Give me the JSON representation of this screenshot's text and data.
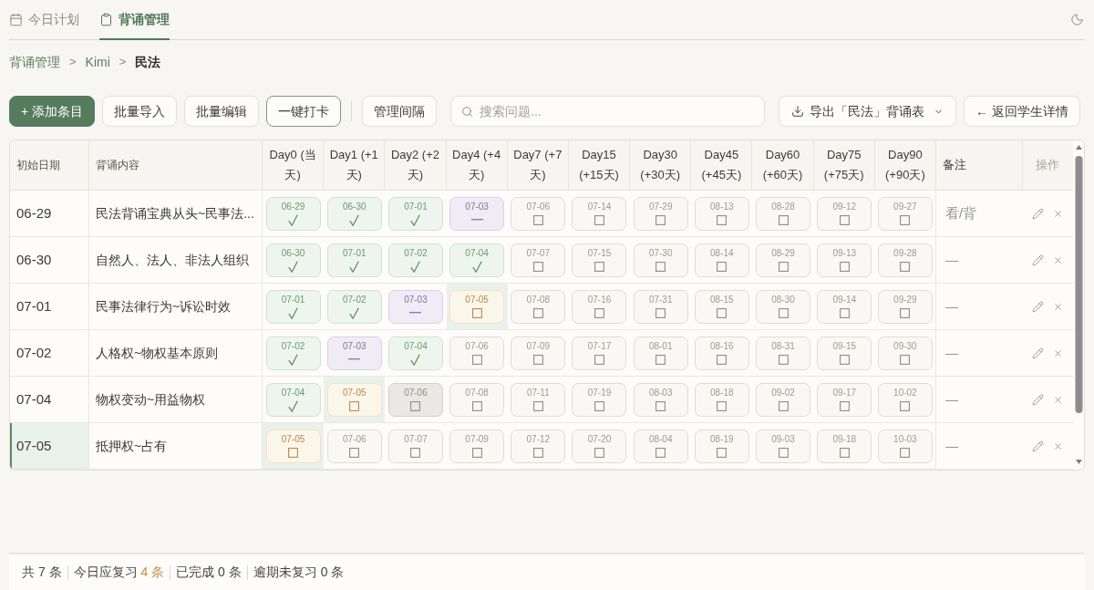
{
  "tabs": [
    {
      "label": "今日计划",
      "selected": false
    },
    {
      "label": "背诵管理",
      "selected": true
    }
  ],
  "breadcrumb": [
    {
      "label": "背诵管理",
      "separator": ">",
      "current": false
    },
    {
      "label": "Kimi",
      "separator": ">",
      "current": false
    },
    {
      "label": "民法",
      "current": true
    }
  ],
  "toolbar": {
    "buttons": [
      {
        "label": "+ 添加条目",
        "kind": "primary"
      },
      {
        "label": "批量导入",
        "kind": "default"
      },
      {
        "label": "批量编辑",
        "kind": "default"
      },
      {
        "label": "一键打卡",
        "kind": "accent"
      }
    ],
    "interval_button": {
      "label": "管理间隔"
    },
    "search": {
      "placeholder": "搜索问题..."
    },
    "export_button": {
      "label": "导出「民法」背诵表"
    },
    "back_button": {
      "label": "← 返回学生详情"
    }
  },
  "table": {
    "columns": [
      "初始日期",
      "背诵内容",
      "Day0 (当天)",
      "Day1 (+1天)",
      "Day2 (+2天)",
      "Day4 (+4天)",
      "Day7 (+7天)",
      "Day15 (+15天)",
      "Day30 (+30天)",
      "Day45 (+45天)",
      "Day60 (+60天)",
      "Day75 (+75天)",
      "Day90 (+90天)",
      "备注",
      "操作"
    ],
    "rows": [
      {
        "start": "06-29",
        "content": "民法背诵宝典从头~民事法...",
        "highlighted": false,
        "note": "看/背",
        "reviews": [
          {
            "date": "06-29",
            "kind": "done"
          },
          {
            "date": "06-30",
            "kind": "done"
          },
          {
            "date": "07-01",
            "kind": "done"
          },
          {
            "date": "07-03",
            "kind": "skipped"
          },
          {
            "date": "07-06",
            "kind": "pending"
          },
          {
            "date": "07-14",
            "kind": "pending"
          },
          {
            "date": "07-29",
            "kind": "pending"
          },
          {
            "date": "08-13",
            "kind": "pending"
          },
          {
            "date": "08-28",
            "kind": "pending"
          },
          {
            "date": "09-12",
            "kind": "pending"
          },
          {
            "date": "09-27",
            "kind": "pending"
          }
        ]
      },
      {
        "start": "06-30",
        "content": "自然人、法人、非法人组织",
        "highlighted": false,
        "note": "—",
        "reviews": [
          {
            "date": "06-30",
            "kind": "done"
          },
          {
            "date": "07-01",
            "kind": "done"
          },
          {
            "date": "07-02",
            "kind": "done"
          },
          {
            "date": "07-04",
            "kind": "done"
          },
          {
            "date": "07-07",
            "kind": "pending"
          },
          {
            "date": "07-15",
            "kind": "pending"
          },
          {
            "date": "07-30",
            "kind": "pending"
          },
          {
            "date": "08-14",
            "kind": "pending"
          },
          {
            "date": "08-29",
            "kind": "pending"
          },
          {
            "date": "09-13",
            "kind": "pending"
          },
          {
            "date": "09-28",
            "kind": "pending"
          }
        ]
      },
      {
        "start": "07-01",
        "content": "民事法律行为~诉讼时效",
        "highlighted": false,
        "note": "—",
        "reviews": [
          {
            "date": "07-01",
            "kind": "done"
          },
          {
            "date": "07-02",
            "kind": "done"
          },
          {
            "date": "07-03",
            "kind": "skipped"
          },
          {
            "date": "07-05",
            "kind": "due"
          },
          {
            "date": "07-08",
            "kind": "pending"
          },
          {
            "date": "07-16",
            "kind": "pending"
          },
          {
            "date": "07-31",
            "kind": "pending"
          },
          {
            "date": "08-15",
            "kind": "pending"
          },
          {
            "date": "08-30",
            "kind": "pending"
          },
          {
            "date": "09-14",
            "kind": "pending"
          },
          {
            "date": "09-29",
            "kind": "pending"
          }
        ]
      },
      {
        "start": "07-02",
        "content": "人格权~物权基本原则",
        "highlighted": false,
        "note": "—",
        "reviews": [
          {
            "date": "07-02",
            "kind": "done"
          },
          {
            "date": "07-03",
            "kind": "skipped"
          },
          {
            "date": "07-04",
            "kind": "done"
          },
          {
            "date": "07-06",
            "kind": "pending"
          },
          {
            "date": "07-09",
            "kind": "pending"
          },
          {
            "date": "07-17",
            "kind": "pending"
          },
          {
            "date": "08-01",
            "kind": "pending"
          },
          {
            "date": "08-16",
            "kind": "pending"
          },
          {
            "date": "08-31",
            "kind": "pending"
          },
          {
            "date": "09-15",
            "kind": "pending"
          },
          {
            "date": "09-30",
            "kind": "pending"
          }
        ]
      },
      {
        "start": "07-04",
        "content": "物权变动~用益物权",
        "highlighted": false,
        "note": "—",
        "reviews": [
          {
            "date": "07-04",
            "kind": "done"
          },
          {
            "date": "07-05",
            "kind": "due"
          },
          {
            "date": "07-06",
            "kind": "muted"
          },
          {
            "date": "07-08",
            "kind": "pending"
          },
          {
            "date": "07-11",
            "kind": "pending"
          },
          {
            "date": "07-19",
            "kind": "pending"
          },
          {
            "date": "08-03",
            "kind": "pending"
          },
          {
            "date": "08-18",
            "kind": "pending"
          },
          {
            "date": "09-02",
            "kind": "pending"
          },
          {
            "date": "09-17",
            "kind": "pending"
          },
          {
            "date": "10-02",
            "kind": "pending"
          }
        ]
      },
      {
        "start": "07-05",
        "content": "抵押权~占有",
        "highlighted": true,
        "note": "—",
        "reviews": [
          {
            "date": "07-05",
            "kind": "due"
          },
          {
            "date": "07-06",
            "kind": "pending"
          },
          {
            "date": "07-07",
            "kind": "pending"
          },
          {
            "date": "07-09",
            "kind": "pending"
          },
          {
            "date": "07-12",
            "kind": "pending"
          },
          {
            "date": "07-20",
            "kind": "pending"
          },
          {
            "date": "08-04",
            "kind": "pending"
          },
          {
            "date": "08-19",
            "kind": "pending"
          },
          {
            "date": "09-03",
            "kind": "pending"
          },
          {
            "date": "09-18",
            "kind": "pending"
          },
          {
            "date": "10-03",
            "kind": "pending"
          }
        ]
      }
    ]
  },
  "status_bar": {
    "items": [
      {
        "label": "共",
        "count": "7 条",
        "alert": false
      },
      {
        "label": "今日应复习",
        "count": "4 条",
        "alert": true
      },
      {
        "label": "已完成",
        "count": "0 条",
        "alert": false
      },
      {
        "label": "逾期未复习",
        "count": "0 条",
        "alert": false
      }
    ]
  }
}
